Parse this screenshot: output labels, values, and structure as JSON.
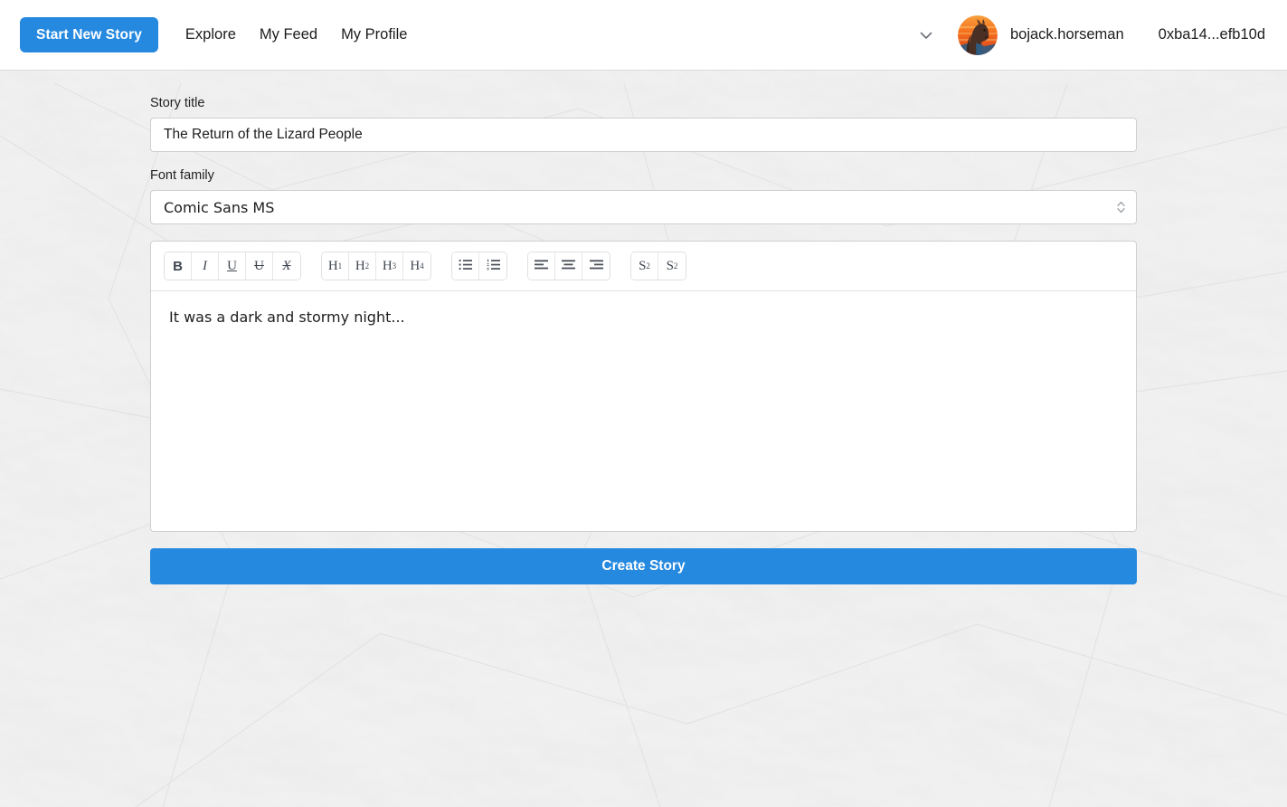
{
  "navbar": {
    "primary_button": "Start New Story",
    "links": [
      {
        "label": "Explore",
        "name": "nav-link-explore"
      },
      {
        "label": "My Feed",
        "name": "nav-link-my-feed"
      },
      {
        "label": "My Profile",
        "name": "nav-link-my-profile"
      }
    ],
    "chevron_icon": "chevron-down-icon",
    "avatar_icon": "horse-avatar",
    "username": "bojack.horseman",
    "wallet_address": "0xba14...efb10d"
  },
  "form": {
    "title_label": "Story title",
    "title_value": "The Return of the Lizard People",
    "title_placeholder": "Story title",
    "font_label": "Font family",
    "font_value": "Comic Sans MS",
    "select_arrows_icon": "chevron-up-down-icon"
  },
  "toolbar": {
    "groups": [
      {
        "name": "inline-format-group",
        "buttons": [
          {
            "label": "B",
            "name": "bold-button",
            "class": "bold"
          },
          {
            "label": "I",
            "name": "italic-button",
            "class": "italic"
          },
          {
            "label": "U",
            "name": "underline-button",
            "class": "under"
          },
          {
            "label": "U",
            "name": "strikethrough-button",
            "class": "strike"
          },
          {
            "label": "X",
            "name": "clear-format-button",
            "class": "clear"
          }
        ]
      },
      {
        "name": "heading-group",
        "buttons": [
          {
            "label": "H",
            "num": "1",
            "name": "heading-1-button",
            "class": "heading"
          },
          {
            "label": "H",
            "num": "2",
            "name": "heading-2-button",
            "class": "heading"
          },
          {
            "label": "H",
            "num": "3",
            "name": "heading-3-button",
            "class": "heading"
          },
          {
            "label": "H",
            "num": "4",
            "name": "heading-4-button",
            "class": "heading"
          }
        ]
      },
      {
        "name": "list-group",
        "buttons": [
          {
            "icon": "bullet-list-icon",
            "name": "bullet-list-button"
          },
          {
            "icon": "ordered-list-icon",
            "name": "ordered-list-button"
          }
        ]
      },
      {
        "name": "align-group",
        "buttons": [
          {
            "icon": "align-left-icon",
            "name": "align-left-button"
          },
          {
            "icon": "align-center-icon",
            "name": "align-center-button"
          },
          {
            "icon": "align-right-icon",
            "name": "align-right-button"
          }
        ]
      },
      {
        "name": "script-group",
        "buttons": [
          {
            "label": "S",
            "sup": "2",
            "name": "superscript-button"
          },
          {
            "label": "S",
            "sub": "2",
            "name": "subscript-button"
          }
        ]
      }
    ]
  },
  "editor": {
    "body_text": "It was a dark and stormy night..."
  },
  "actions": {
    "create_story": "Create Story"
  },
  "colors": {
    "accent_blue": "#2589e0",
    "page_background": "#eeeeee",
    "navbar_background": "#ffffff",
    "field_border": "#cfcfcf",
    "text_primary": "#1c1c1c"
  }
}
